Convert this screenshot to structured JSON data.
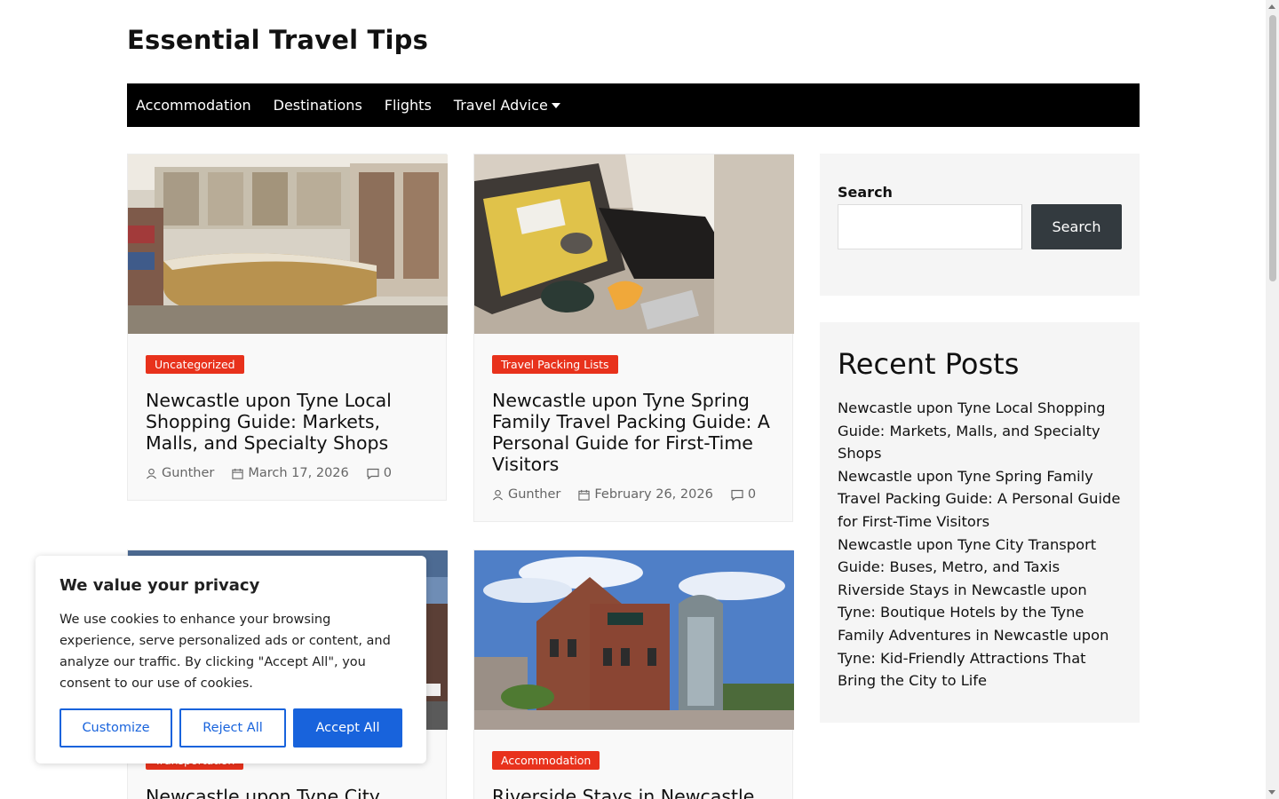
{
  "site": {
    "title": "Essential Travel Tips"
  },
  "nav": {
    "items": [
      "Accommodation",
      "Destinations",
      "Flights",
      "Travel Advice"
    ]
  },
  "posts": [
    {
      "category": "Uncategorized",
      "title": "Newcastle upon Tyne Local Shopping Guide: Markets, Malls, and Specialty Shops",
      "author": "Gunther",
      "date": "March 17, 2026",
      "comments": "0",
      "image": "department-store-interior"
    },
    {
      "category": "Travel Packing Lists",
      "title": "Newcastle upon Tyne Spring Family Travel Packing Guide: A Personal Guide for First-Time Visitors",
      "author": "Gunther",
      "date": "February 26, 2026",
      "comments": "0",
      "image": "packing-suitcase"
    },
    {
      "category": "Transportation",
      "title": "Newcastle upon Tyne City",
      "image": "city-street"
    },
    {
      "category": "Accommodation",
      "title": "Riverside Stays in Newcastle",
      "image": "hotel-du-vin-building"
    }
  ],
  "sidebar": {
    "search": {
      "label": "Search",
      "button_label": "Search",
      "value": ""
    },
    "recent_posts": {
      "title": "Recent Posts",
      "items": [
        "Newcastle upon Tyne Local Shopping Guide: Markets, Malls, and Specialty Shops",
        "Newcastle upon Tyne Spring Family Travel Packing Guide: A Personal Guide for First-Time Visitors",
        "Newcastle upon Tyne City Transport Guide: Buses, Metro, and Taxis",
        "Riverside Stays in Newcastle upon Tyne: Boutique Hotels by the Tyne",
        "Family Adventures in Newcastle upon Tyne: Kid-Friendly Attractions That Bring the City to Life"
      ]
    }
  },
  "cookie_banner": {
    "title": "We value your privacy",
    "text": "We use cookies to enhance your browsing experience, serve personalized ads or content, and analyze our traffic. By clicking \"Accept All\", you consent to our use of cookies.",
    "customize_label": "Customize",
    "reject_label": "Reject All",
    "accept_label": "Accept All"
  },
  "colors": {
    "nav_bg": "#000000",
    "badge": "#e8321c",
    "search_button": "#333a3f",
    "cookie_accent": "#1863dc"
  }
}
